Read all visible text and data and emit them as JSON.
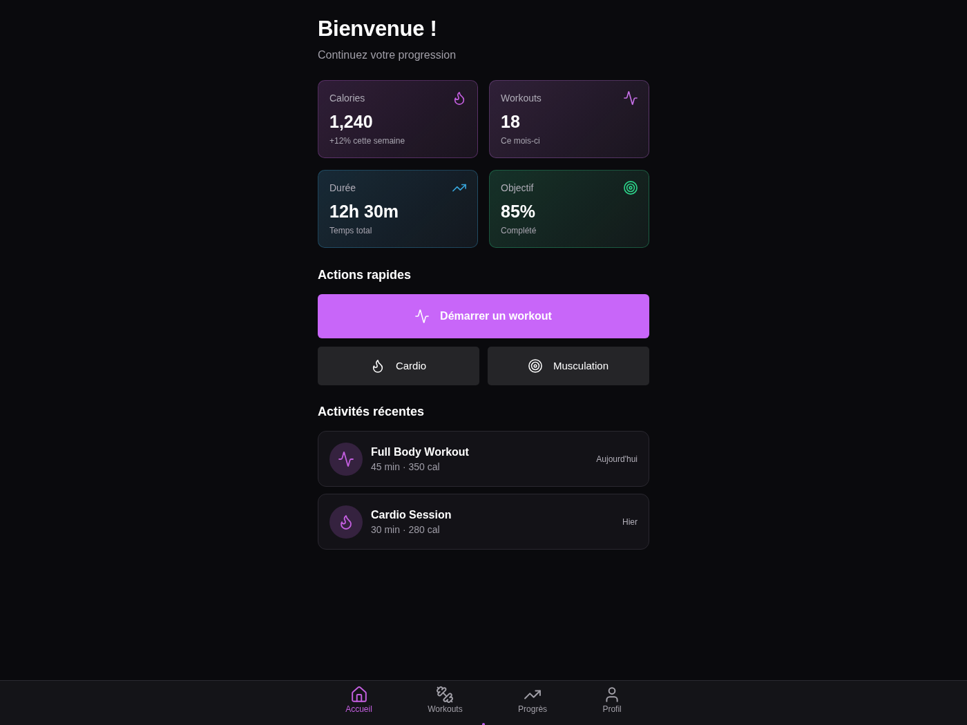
{
  "header": {
    "title": "Bienvenue !",
    "subtitle": "Continuez votre progression"
  },
  "stats": [
    {
      "kind": "calories",
      "label": "Calories",
      "value": "1,240",
      "note": "+12% cette semaine",
      "color": "#c45fe0"
    },
    {
      "kind": "workouts",
      "label": "Workouts",
      "value": "18",
      "note": "Ce mois-ci",
      "color": "#c56fe6"
    },
    {
      "kind": "duration",
      "label": "Durée",
      "value": "12h 30m",
      "note": "Temps total",
      "color": "#38a6dc"
    },
    {
      "kind": "goal",
      "label": "Objectif",
      "value": "85%",
      "note": "Complété",
      "color": "#2dd38a"
    }
  ],
  "quick_actions": {
    "title": "Actions rapides",
    "buttons": [
      {
        "kind": "start",
        "label": "Démarrer un workout"
      },
      {
        "kind": "cardio",
        "label": "Cardio"
      },
      {
        "kind": "strength",
        "label": "Musculation"
      }
    ]
  },
  "recent": {
    "title": "Activités récentes",
    "items": [
      {
        "kind": "workout",
        "title": "Full Body Workout",
        "details": "45 min · 350 cal",
        "when": "Aujourd'hui"
      },
      {
        "kind": "cardio",
        "title": "Cardio Session",
        "details": "30 min · 280 cal",
        "when": "Hier"
      }
    ]
  },
  "bottom_nav": [
    {
      "kind": "home",
      "label": "Accueil",
      "selected": true
    },
    {
      "kind": "workouts",
      "label": "Workouts",
      "selected": false
    },
    {
      "kind": "progress",
      "label": "Progrès",
      "selected": false
    },
    {
      "kind": "profile",
      "label": "Profil",
      "selected": false
    }
  ]
}
